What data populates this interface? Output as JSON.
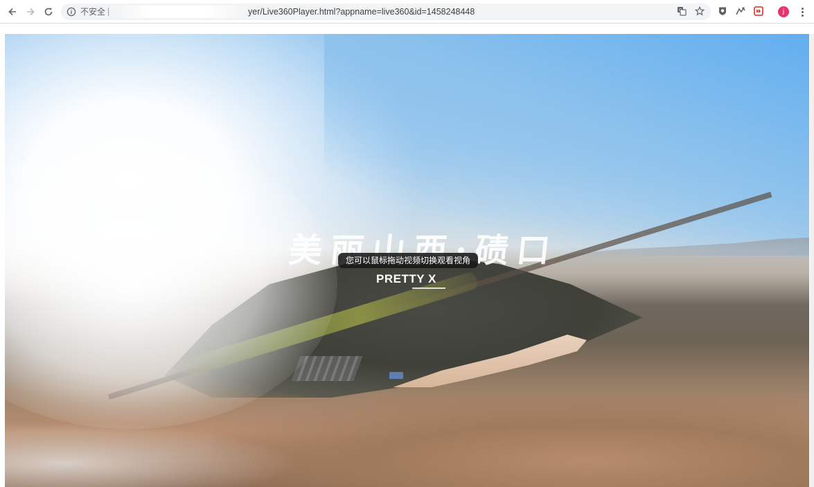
{
  "browser": {
    "security_label": "不安全",
    "url_visible": "yer/Live360Player.html?appname=live360&id=1458248448",
    "avatar_initial": "j",
    "accent_avatar": "#e8336d",
    "icons": [
      "back-icon",
      "forward-icon",
      "reload-icon",
      "info-icon",
      "translate-icon",
      "star-icon",
      "extension-shield-icon",
      "extension-paw-icon",
      "extension-record-icon",
      "profile-avatar",
      "menu-kebab-icon"
    ]
  },
  "player": {
    "overlay_title": "美丽山西·碛口",
    "tooltip": "您可以鼠标拖动视频切换观看视角",
    "brand": "PRETTY X"
  }
}
